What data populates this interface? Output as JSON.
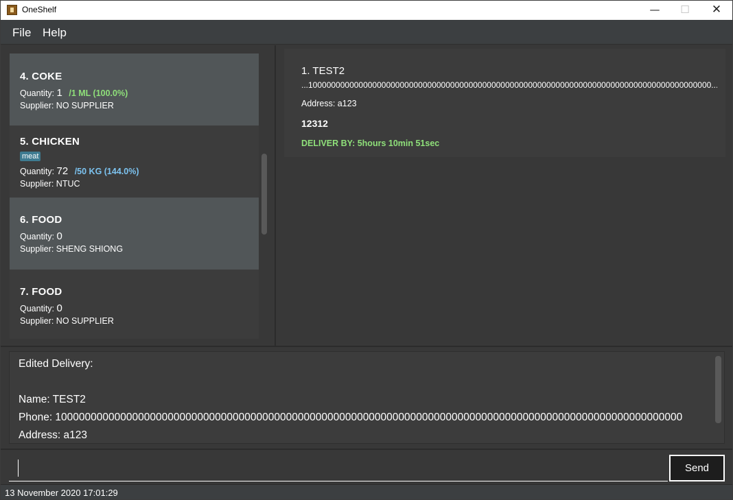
{
  "window": {
    "title": "OneShelf",
    "minimize_glyph": "—",
    "maximize_glyph": "☐",
    "close_glyph": "✕"
  },
  "menu": {
    "file": "File",
    "help": "Help"
  },
  "inventory": {
    "items": [
      {
        "title": "4.  COKE",
        "quantity_label": "Quantity:",
        "quantity": "1",
        "max": "/1 ML (100.0%)",
        "supplier": "Supplier: NO SUPPLIER"
      },
      {
        "title": "5.  CHICKEN",
        "tag": "meat",
        "quantity_label": "Quantity:",
        "quantity": "72",
        "max": "/50 KG (144.0%)",
        "supplier": "Supplier: NTUC"
      },
      {
        "title": "6.  FOOD",
        "quantity_label": "Quantity:",
        "quantity": "0",
        "supplier": "Supplier: SHENG SHIONG"
      },
      {
        "title": "7.  FOOD",
        "quantity_label": "Quantity:",
        "quantity": "0",
        "supplier": "Supplier: NO SUPPLIER"
      }
    ]
  },
  "delivery": {
    "title": "1.  TEST2",
    "phone": "...1000000000000000000000000000000000000000000000000000000000000000000000000000000000000000...",
    "address": "Address: a123",
    "remarks": "12312",
    "deliver_by": "DELIVER BY: 5hours 10min 51sec"
  },
  "result": {
    "lines": [
      "Edited Delivery:",
      "",
      "Name: TEST2",
      "Phone: 1000000000000000000000000000000000000000000000000000000000000000000000000000000000000000000000000000000000",
      "Address: a123"
    ]
  },
  "command": {
    "value": "",
    "send_label": "Send"
  },
  "status": {
    "datetime": "13 November 2020 17:01:29"
  }
}
